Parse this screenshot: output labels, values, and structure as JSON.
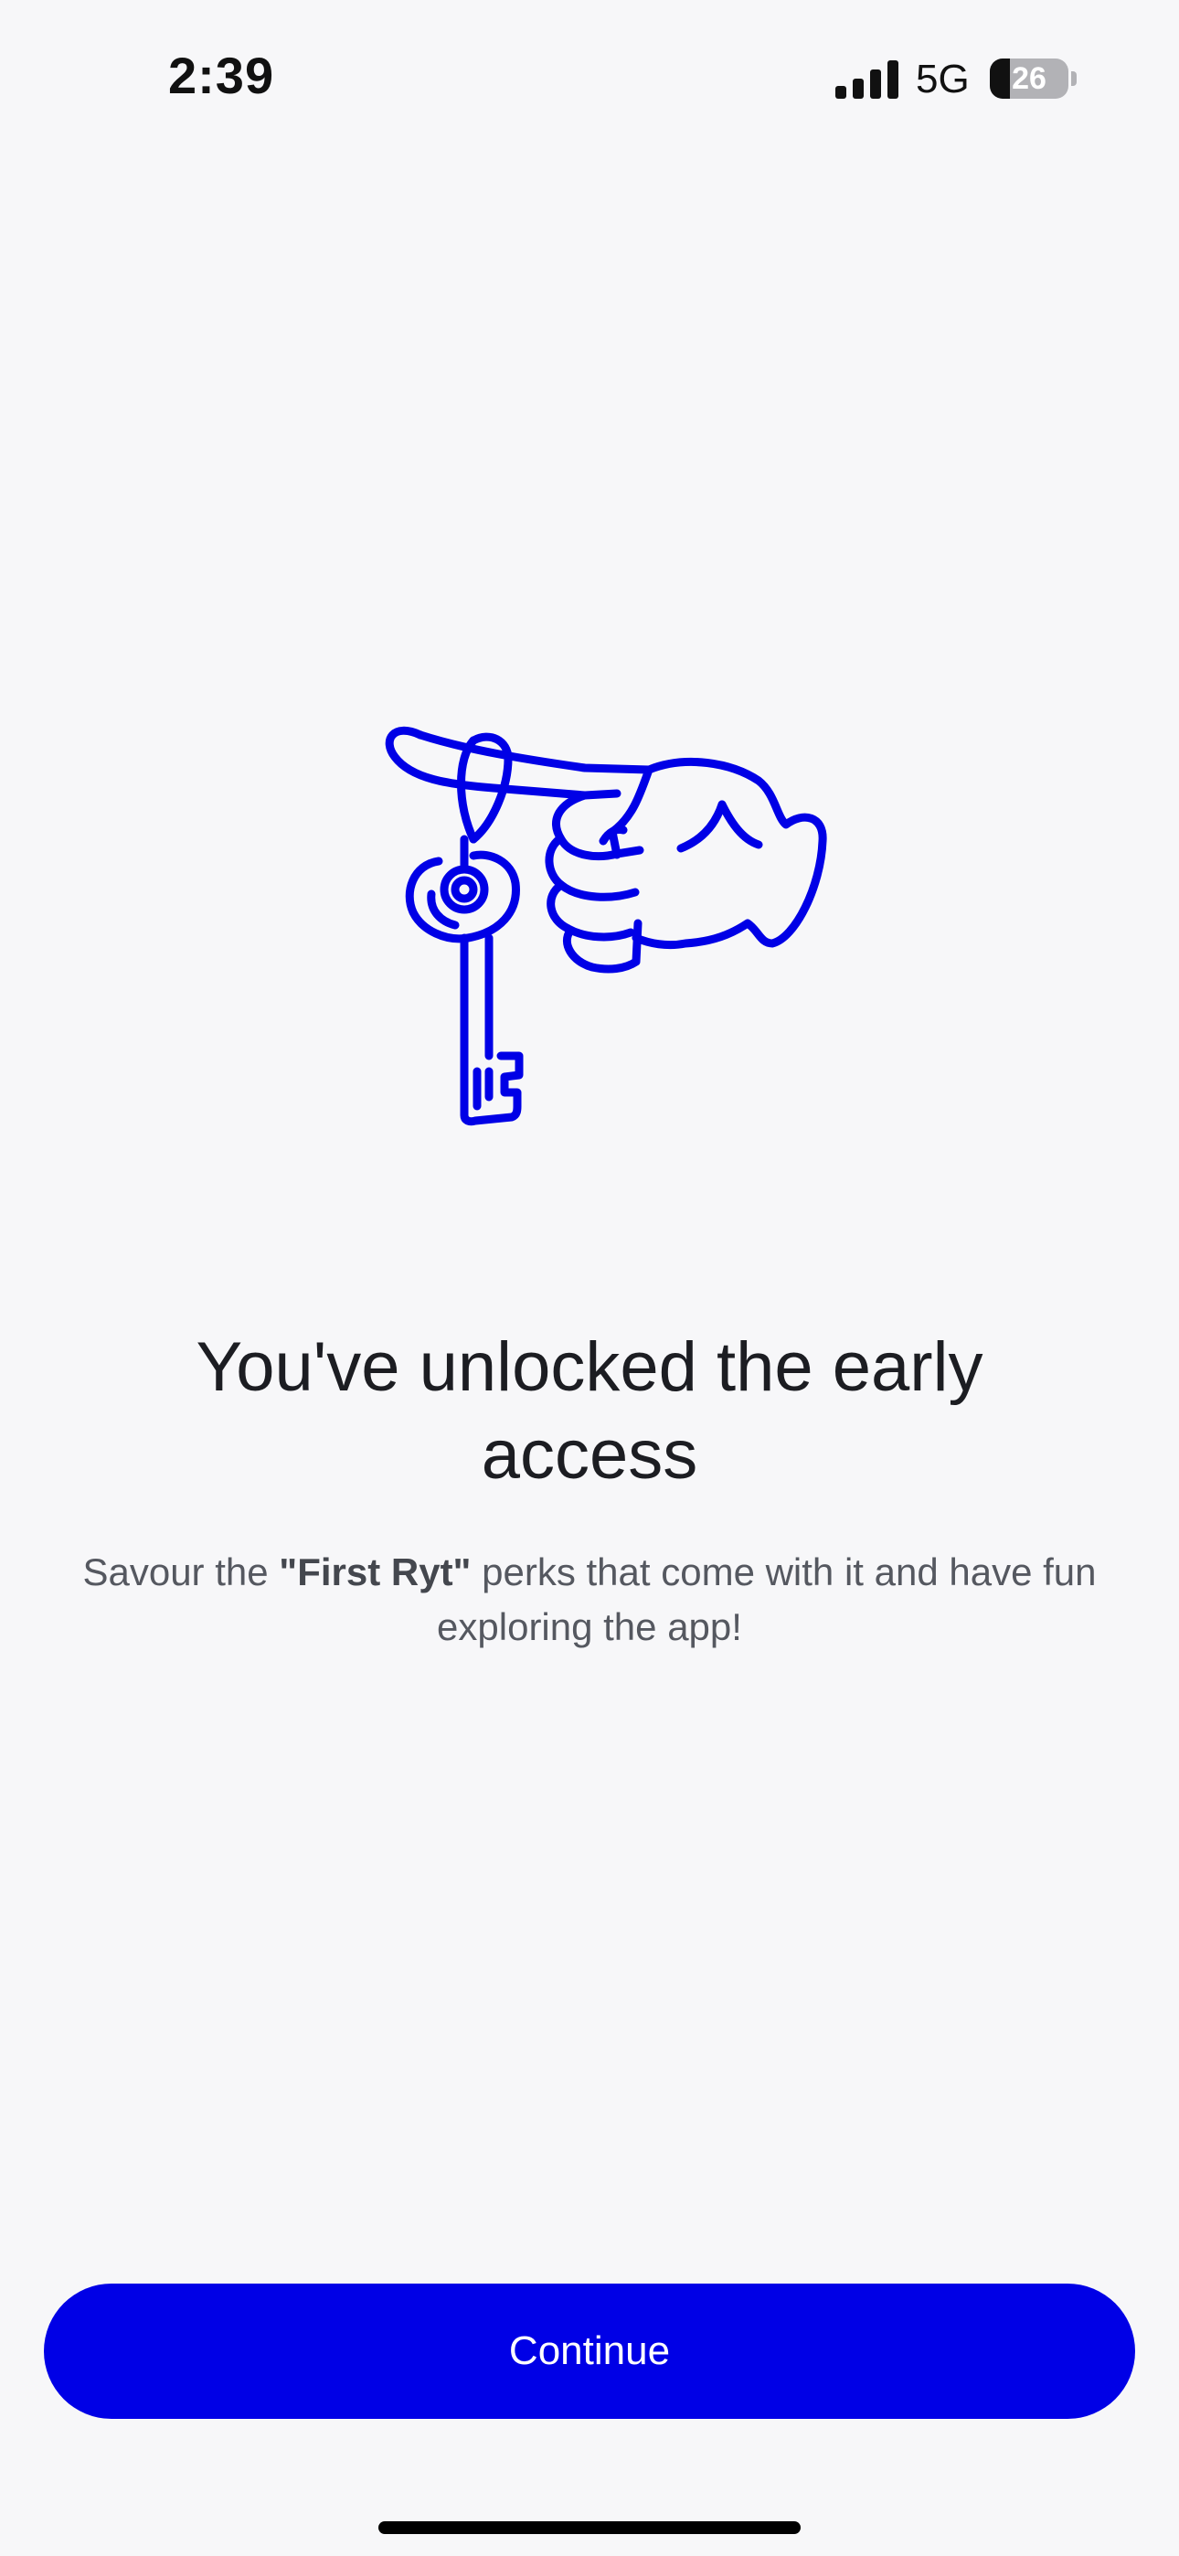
{
  "status_bar": {
    "time": "2:39",
    "network": "5G",
    "battery_level": "26",
    "battery_fraction": 0.26
  },
  "illustration": {
    "icon": "hand-holding-key-icon",
    "color": "#0000e6"
  },
  "content": {
    "headline": "You've unlocked the early access",
    "subtitle_prefix": "Savour the ",
    "subtitle_highlight": "\"First Ryt\"",
    "subtitle_suffix": " perks that come with it and have fun exploring the app!"
  },
  "actions": {
    "continue_label": "Continue"
  },
  "colors": {
    "accent": "#0000e6",
    "background": "#f7f7f9",
    "headline": "#1c1d22",
    "body_text": "#555860"
  }
}
